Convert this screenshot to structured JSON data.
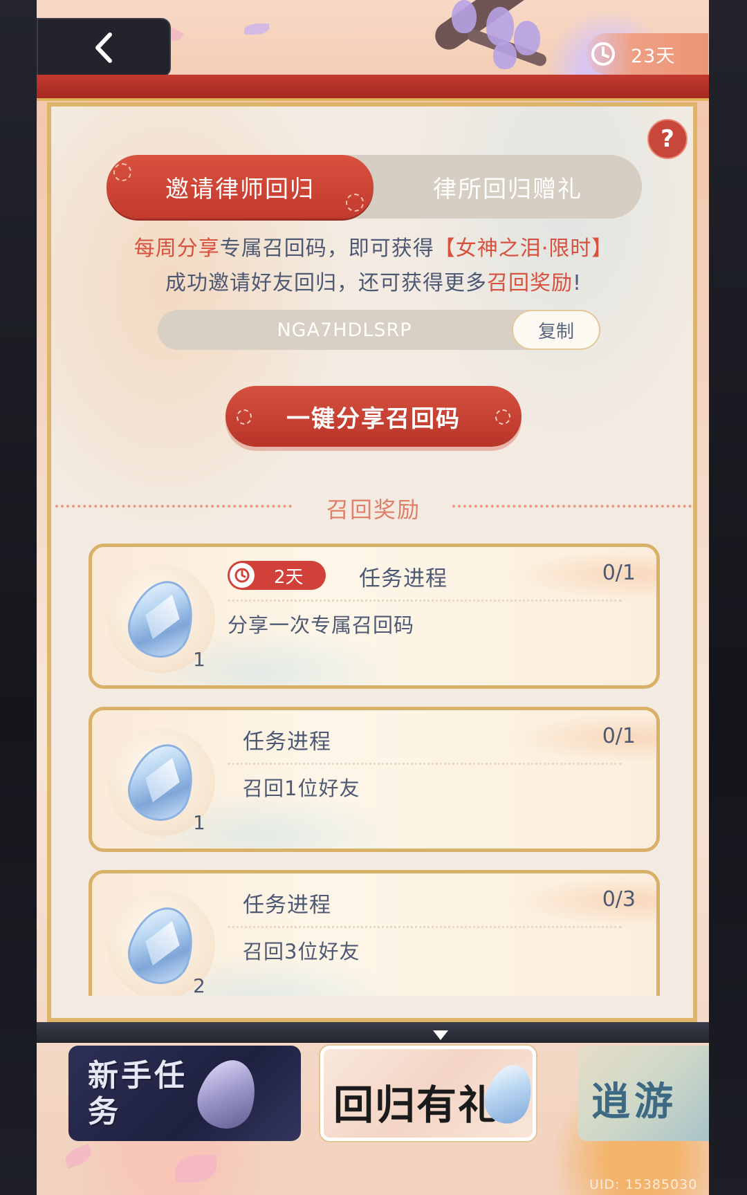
{
  "header": {
    "back_label": "",
    "timer_text": "23天"
  },
  "tabs": [
    {
      "label": "邀请律师回归",
      "active": true
    },
    {
      "label": "律所回归赠礼",
      "active": false
    }
  ],
  "description": {
    "line1_prefix": "每周分享",
    "line1_mid": "专属召回码，即可获得",
    "line1_reward": "【女神之泪·限时】",
    "line2_prefix": "成功邀请好友回归，还可获得更多",
    "line2_highlight": "召回奖励",
    "line2_suffix": "!"
  },
  "invite_code": {
    "code": "NGA7HDLSRP",
    "copy_label": "复制"
  },
  "share_button_label": "一键分享召回码",
  "section_title": "召回奖励",
  "tasks": [
    {
      "timer": "2天",
      "title": "任务进程",
      "progress": "0/1",
      "description": "分享一次专属召回码",
      "reward_count": "1"
    },
    {
      "title": "任务进程",
      "progress": "0/1",
      "description": "召回1位好友",
      "reward_count": "1"
    },
    {
      "title": "任务进程",
      "progress": "0/3",
      "description": "召回3位好友",
      "reward_count": "2"
    }
  ],
  "bottom_tabs": [
    {
      "label": "新手任务"
    },
    {
      "label": "回归有礼"
    },
    {
      "label": "逍游"
    }
  ],
  "uid_text": "UID: 15385030",
  "colors": {
    "accent_red": "#c23a2d",
    "highlight_text": "#d8503e",
    "body_text": "#4d5873",
    "gold_border": "#dcb56a"
  }
}
